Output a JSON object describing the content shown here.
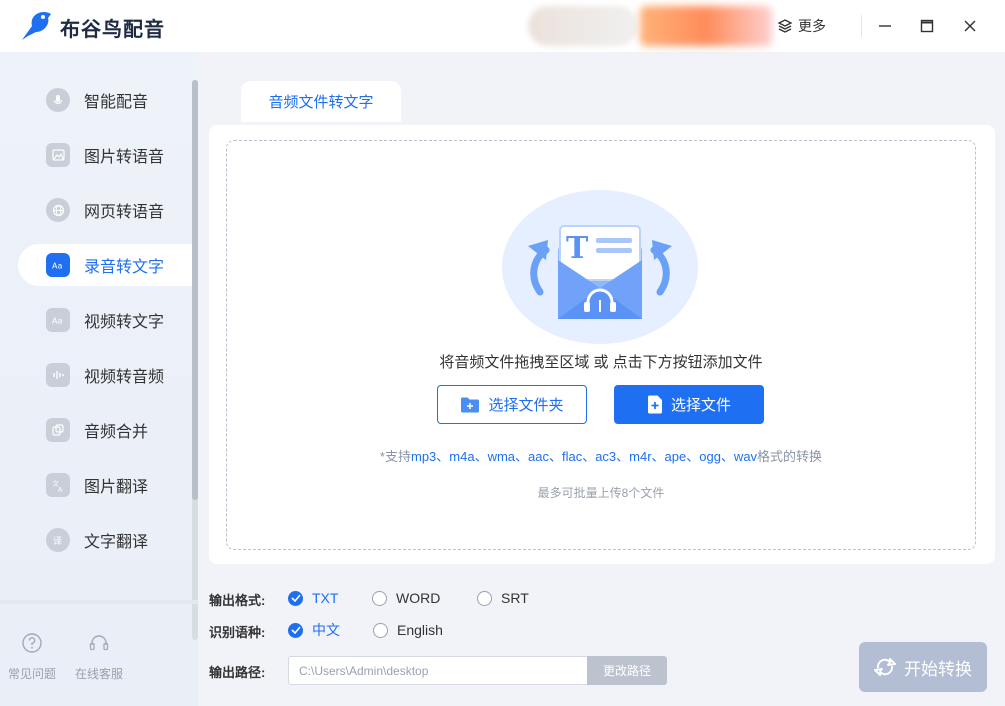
{
  "app": {
    "title": "布谷鸟配音"
  },
  "header": {
    "more_label": "更多"
  },
  "sidebar": {
    "items": [
      {
        "label": "智能配音",
        "icon": "mic-icon",
        "active": false
      },
      {
        "label": "图片转语音",
        "icon": "image-icon",
        "active": false
      },
      {
        "label": "网页转语音",
        "icon": "globe-icon",
        "active": false
      },
      {
        "label": "录音转文字",
        "icon": "text-aa-icon",
        "active": true
      },
      {
        "label": "视频转文字",
        "icon": "video-text-icon",
        "active": false
      },
      {
        "label": "视频转音频",
        "icon": "video-audio-icon",
        "active": false
      },
      {
        "label": "音频合并",
        "icon": "merge-icon",
        "active": false
      },
      {
        "label": "图片翻译",
        "icon": "translate-icon",
        "active": false
      },
      {
        "label": "文字翻译",
        "icon": "text-translate-icon",
        "active": false
      }
    ],
    "footer": [
      {
        "label": "常见问题",
        "icon": "question-icon"
      },
      {
        "label": "在线客服",
        "icon": "headset-icon"
      }
    ]
  },
  "main": {
    "tab_label": "音频文件转文字",
    "drop_hint": "将音频文件拖拽至区域 或 点击下方按钮添加文件",
    "select_folder_label": "选择文件夹",
    "select_file_label": "选择文件",
    "formats_prefix": "*支持",
    "formats_list": "mp3、m4a、wma、aac、flac、ac3、m4r、ape、ogg、wav",
    "formats_suffix": "格式的转换",
    "limit_note": "最多可批量上传8个文件"
  },
  "options": {
    "format_label": "输出格式:",
    "formats": [
      {
        "label": "TXT",
        "checked": true
      },
      {
        "label": "WORD",
        "checked": false
      },
      {
        "label": "SRT",
        "checked": false
      }
    ],
    "language_label": "识别语种:",
    "languages": [
      {
        "label": "中文",
        "checked": true
      },
      {
        "label": "English",
        "checked": false
      }
    ],
    "path_label": "输出路径:",
    "path_value": "C:\\Users\\Admin\\desktop",
    "change_path_label": "更改路径",
    "start_label": "开始转换"
  },
  "colors": {
    "accent": "#1e6ff1",
    "start_button": "#b3bdd4",
    "sidebar_bg": "#eef2f9"
  }
}
